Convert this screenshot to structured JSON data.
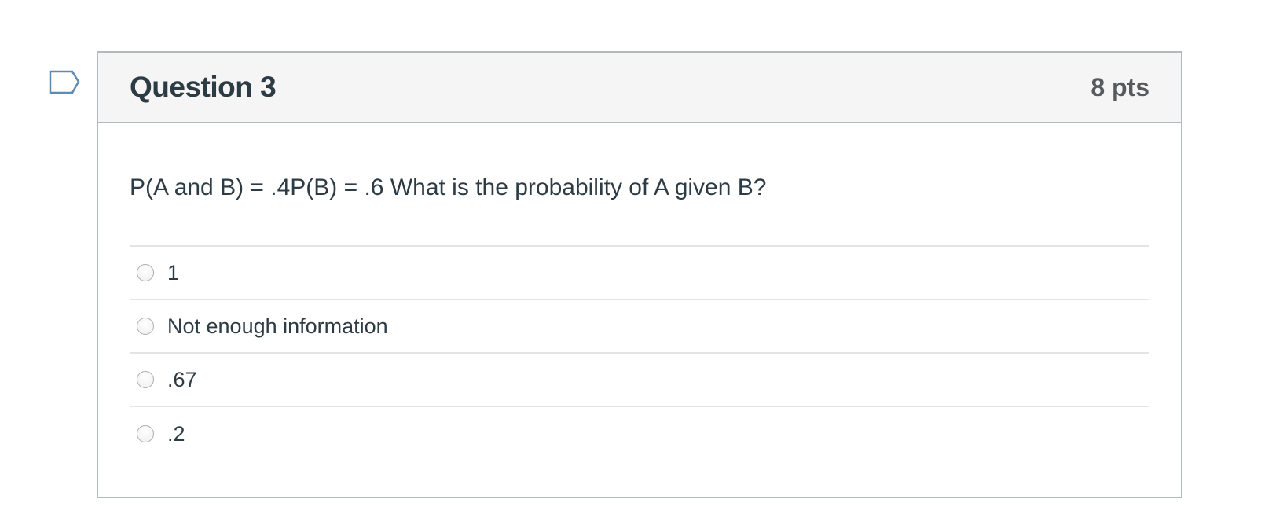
{
  "question": {
    "title": "Question 3",
    "points": "8 pts",
    "text": "P(A and B) = .4P(B) = .6 What is the probability of A given B?",
    "answers": [
      {
        "label": "1",
        "selected": false
      },
      {
        "label": "Not enough information",
        "selected": false
      },
      {
        "label": ".67",
        "selected": false
      },
      {
        "label": ".2",
        "selected": false
      }
    ]
  },
  "icons": {
    "flag": "flag-question-icon"
  },
  "colors": {
    "flag_stroke": "#5d8bb3",
    "header_bg": "#f5f5f5",
    "border": "#b4b9bd",
    "text": "#2d3b45",
    "points_text": "#565a5c"
  }
}
